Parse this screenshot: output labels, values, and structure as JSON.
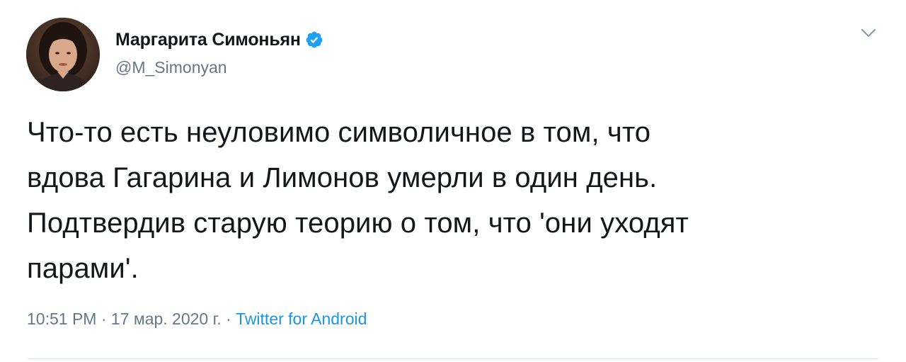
{
  "tweet": {
    "author": {
      "display_name": "Маргарита Симоньян",
      "handle": "@M_Simonyan",
      "verified": true
    },
    "text": "Что-то есть неуловимо символичное в том, что\nвдова Гагарина и Лимонов умерли в один день.\nПодтвердив старую теорию о том, что 'они уходят\nпарами'.",
    "meta": {
      "time": "10:51 PM",
      "separator": " · ",
      "date": "17 мар. 2020 г.",
      "source": "Twitter for Android"
    }
  },
  "icons": {
    "verified": "verified-badge-icon",
    "caret": "chevron-down-icon"
  },
  "colors": {
    "accent": "#1da1f2",
    "source_link": "#1b95e0",
    "secondary_text": "#657786",
    "primary_text": "#14171a"
  }
}
